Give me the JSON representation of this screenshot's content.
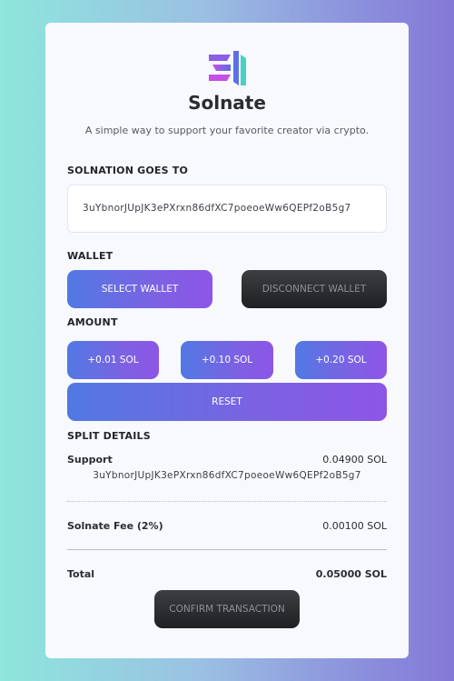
{
  "brand": {
    "name": "Solnate",
    "tagline": "A simple way to support your favorite creator via crypto."
  },
  "recipient": {
    "label": "SOLNATION GOES TO",
    "address": "3uYbnorJUpJK3ePXrxn86dfXC7poeoeWw6QEPf2oB5g7"
  },
  "wallet": {
    "label": "WALLET",
    "select_label": "SELECT WALLET",
    "disconnect_label": "DISCONNECT WALLET"
  },
  "amount": {
    "label": "AMOUNT",
    "options": [
      "+0.01 SOL",
      "+0.10 SOL",
      "+0.20 SOL"
    ],
    "reset_label": "RESET"
  },
  "split": {
    "label": "SPLIT DETAILS",
    "support_label": "Support",
    "support_value": "0.04900 SOL",
    "support_address": "3uYbnorJUpJK3ePXrxn86dfXC7poeoeWw6QEPf2oB5g7",
    "fee_label": "Solnate Fee (2%)",
    "fee_value": "0.00100 SOL",
    "total_label": "Total",
    "total_value": "0.05000 SOL"
  },
  "confirm_label": "CONFIRM TRANSACTION",
  "colors": {
    "accent_start": "#5179e3",
    "accent_end": "#8d55e6",
    "dark_button": "#2a2b2f",
    "card_bg": "#f7f9fc"
  },
  "icons": {
    "logo": "solnate-logo-icon"
  }
}
